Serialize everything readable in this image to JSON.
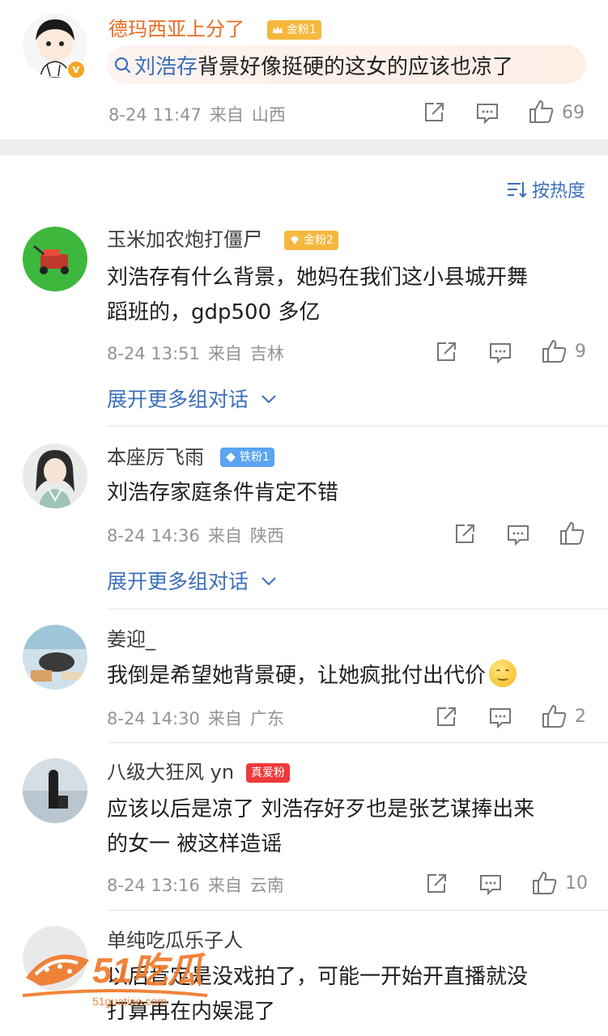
{
  "post": {
    "username": "德玛西亚上分了",
    "badge": "金粉1",
    "quote_topic": "刘浩存",
    "quote_text": "背景好像挺硬的这女的应该也凉了",
    "time": "8-24 11:47",
    "source_prefix": "来自",
    "location": "山西",
    "likes": "69"
  },
  "sort": {
    "label": "按热度"
  },
  "comments": [
    {
      "username": "玉米加农炮打僵尸",
      "badge": "金粉2",
      "text_line1": "刘浩存有什么背景，她妈在我们这小县城开舞",
      "text_line2": "蹈班的，gdp500 多亿",
      "time": "8-24 13:51",
      "source_prefix": "来自",
      "location": "吉林",
      "likes": "9",
      "expand": "展开更多组对话"
    },
    {
      "username": "本座厉飞雨",
      "badge": "铁粉1",
      "text_line1": "刘浩存家庭条件肯定不错",
      "time": "8-24 14:36",
      "source_prefix": "来自",
      "location": "陕西",
      "likes": "",
      "expand": "展开更多组对话"
    },
    {
      "username": "姜迎_",
      "text_line1": "我倒是希望她背景硬，让她疯批付出代价",
      "time": "8-24 14:30",
      "source_prefix": "来自",
      "location": "广东",
      "likes": "2"
    },
    {
      "username": "八级大狂风 yn",
      "badge": "真爱粉",
      "text_line1": "应该以后是凉了 刘浩存好歹也是张艺谋捧出来",
      "text_line2": "的女一 被这样造谣",
      "time": "8-24 13:16",
      "source_prefix": "来自",
      "location": "云南",
      "likes": "10"
    },
    {
      "username": "单纯吃瓜乐子人",
      "text_line1": "以后肯定是没戏拍了，可能一开始开直播就没",
      "text_line2": "打算再在内娱混了"
    }
  ],
  "watermark": {
    "brand": "51吃瓜",
    "url": "51guatiao.com"
  },
  "colors": {
    "accent_blue": "#3b6fba",
    "orange_name": "#e86c24",
    "gold_badge": "#f5b83d",
    "iron_badge": "#5aa4f0",
    "love_badge": "#ee3a3a"
  }
}
